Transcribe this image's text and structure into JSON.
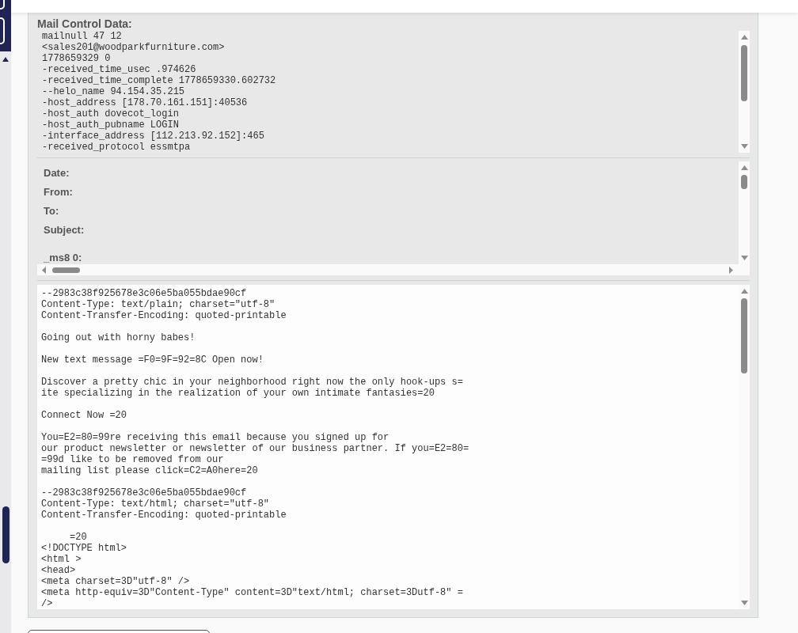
{
  "control_data": {
    "title": "Mail Control Data:",
    "lines": [
      "mailnull 47 12",
      "<sales201@woodparkfurniture.com>",
      "1778659329 0",
      "-received_time_usec .974626",
      "-received_time_complete 1778659330.602732",
      "--helo_name 94.154.35.215",
      "-host_address [178.70.161.151]:40536",
      "-host_auth dovecot_login",
      "-host_auth_pubname LOGIN",
      "-interface_address [112.213.92.152]:465",
      "-received_protocol essmtpa"
    ]
  },
  "headers": {
    "fields": [
      {
        "label": "Date:"
      },
      {
        "label": "From:"
      },
      {
        "label": "To:"
      },
      {
        "label": "Subject:"
      }
    ],
    "extra_fields": [
      {
        "label": "_ms8 0:"
      }
    ]
  },
  "body": {
    "blocks": [
      [
        "--2983c38f925678e3c06e5ba055bdae90cf",
        "Content-Type: text/plain; charset=\"utf-8\"",
        "Content-Transfer-Encoding: quoted-printable"
      ],
      [
        "Going out with horny babes!"
      ],
      [
        "New text message =F0=9F=92=8C Open now!"
      ],
      [
        "Discover a pretty chic in your neighborhood right now the only hook-ups s=",
        "ite specializing in the realization of your own intimate fantasies=20"
      ],
      [
        "Connect Now =20"
      ],
      [
        "You=E2=80=99re receiving this email because you signed up for",
        "our product newsletter or newsletter of our business partner. If you=E2=80=",
        "=99d like to be removed from our",
        "mailing list please click=C2=A0here=20"
      ],
      [
        "--2983c38f925678e3c06e5ba055bdae90cf",
        "Content-Type: text/html; charset=\"utf-8\"",
        "Content-Transfer-Encoding: quoted-printable"
      ],
      [
        "     =20",
        "<!DOCTYPE html>",
        "<html >",
        "<head>",
        "<meta charset=3D\"utf-8\" />",
        "<meta http-equiv=3D\"Content-Type\" content=3D\"text/html; charset=3Dutf-8\" =",
        "/>"
      ]
    ]
  }
}
